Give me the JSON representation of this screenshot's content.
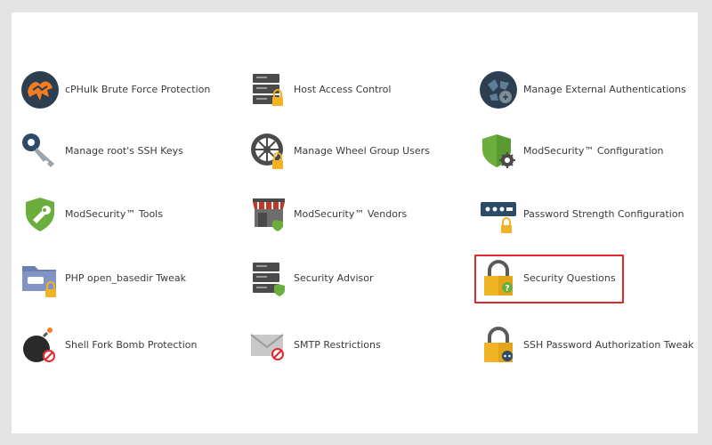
{
  "colors": {
    "highlight": "#e0282e",
    "lock_gold": "#f0b323",
    "server_gray": "#4a4a4a",
    "shield_green": "#6cae3e",
    "navy": "#2c3e50"
  },
  "features": [
    {
      "label": "cPHulk Brute Force Protection",
      "icon": "cphulk-icon"
    },
    {
      "label": "Host Access Control",
      "icon": "server-lock-icon"
    },
    {
      "label": "Manage External Authentications",
      "icon": "external-auth-icon"
    },
    {
      "label": "Manage root's SSH Keys",
      "icon": "ssh-key-icon"
    },
    {
      "label": "Manage Wheel Group Users",
      "icon": "wheel-group-icon"
    },
    {
      "label": "ModSecurity™ Configuration",
      "icon": "shield-gear-icon"
    },
    {
      "label": "ModSecurity™ Tools",
      "icon": "shield-wrench-icon"
    },
    {
      "label": "ModSecurity™ Vendors",
      "icon": "storefront-icon"
    },
    {
      "label": "Password Strength Configuration",
      "icon": "password-icon"
    },
    {
      "label": "PHP open_basedir Tweak",
      "icon": "php-folder-icon"
    },
    {
      "label": "Security Advisor",
      "icon": "server-shield-icon"
    },
    {
      "label": "Security Questions",
      "icon": "padlock-question-icon"
    },
    {
      "label": "Shell Fork Bomb Protection",
      "icon": "bomb-icon"
    },
    {
      "label": "SMTP Restrictions",
      "icon": "envelope-block-icon"
    },
    {
      "label": "SSH Password Authorization Tweak",
      "icon": "padlock-dots-icon"
    }
  ]
}
